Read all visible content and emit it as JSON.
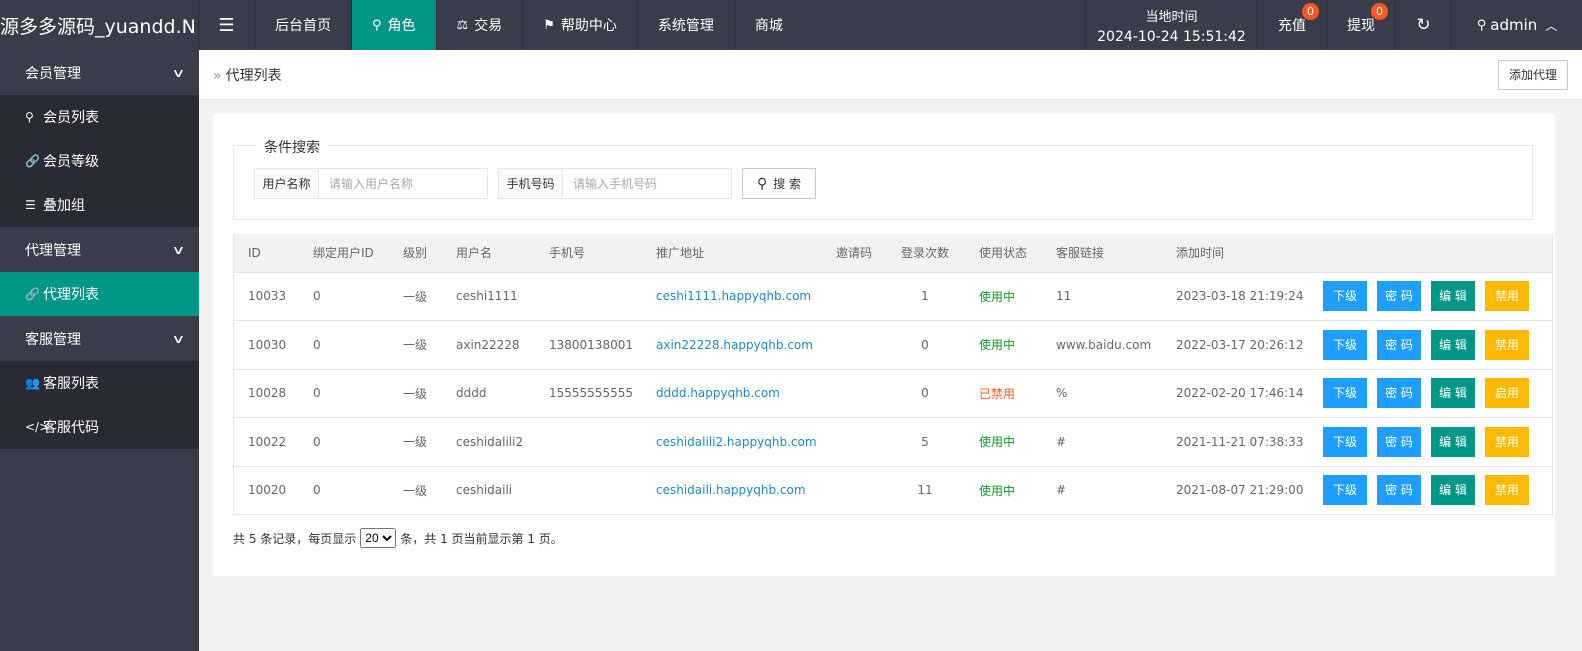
{
  "header": {
    "logo": "源多多源码_yuandd.N...",
    "nav": [
      {
        "label": "后台首页",
        "icon": ""
      },
      {
        "label": "角色",
        "icon": "user-icon"
      },
      {
        "label": "交易",
        "icon": "scale-icon"
      },
      {
        "label": "帮助中心",
        "icon": "flag-icon"
      },
      {
        "label": "系统管理",
        "icon": ""
      },
      {
        "label": "商城",
        "icon": ""
      }
    ],
    "time_label": "当地时间",
    "time_value": "2024-10-24 15:51:42",
    "recharge": {
      "label": "充值",
      "badge": "0"
    },
    "withdraw": {
      "label": "提现",
      "badge": "0"
    },
    "user": "admin"
  },
  "sidebar": {
    "groups": [
      {
        "label": "会员管理",
        "items": [
          "会员列表",
          "会员等级",
          "叠加组"
        ]
      },
      {
        "label": "代理管理",
        "items": [
          "代理列表"
        ]
      },
      {
        "label": "客服管理",
        "items": [
          "客服列表",
          "客服代码"
        ]
      }
    ]
  },
  "breadcrumb": "代理列表",
  "add_button": "添加代理",
  "search": {
    "legend": "条件搜索",
    "username_label": "用户名称",
    "username_placeholder": "请输入用户名称",
    "phone_label": "手机号码",
    "phone_placeholder": "请输入手机号码",
    "button": "搜 索"
  },
  "table": {
    "headers": [
      "ID",
      "绑定用户ID",
      "级别",
      "用户名",
      "手机号",
      "推广地址",
      "邀请码",
      "登录次数",
      "使用状态",
      "客服链接",
      "添加时间",
      ""
    ],
    "rows": [
      {
        "id": "10033",
        "bind": "0",
        "level": "一级",
        "username": "ceshi1111",
        "phone": "",
        "url": "ceshi1111.happyqhb.com",
        "invite": "",
        "logins": "1",
        "status": "使用中",
        "service": "11",
        "time": "2023-03-18 21:19:24",
        "toggle": "禁用"
      },
      {
        "id": "10030",
        "bind": "0",
        "level": "一级",
        "username": "axin22228",
        "phone": "13800138001",
        "url": "axin22228.happyqhb.com",
        "invite": "",
        "logins": "0",
        "status": "使用中",
        "service": "www.baidu.com",
        "time": "2022-03-17 20:26:12",
        "toggle": "禁用"
      },
      {
        "id": "10028",
        "bind": "0",
        "level": "一级",
        "username": "dddd",
        "phone": "15555555555",
        "url": "dddd.happyqhb.com",
        "invite": "",
        "logins": "0",
        "status": "已禁用",
        "service": "%",
        "time": "2022-02-20 17:46:14",
        "toggle": "启用"
      },
      {
        "id": "10022",
        "bind": "0",
        "level": "一级",
        "username": "ceshidalili2",
        "phone": "",
        "url": "ceshidalili2.happyqhb.com",
        "invite": "",
        "logins": "5",
        "status": "使用中",
        "service": "#",
        "time": "2021-11-21 07:38:33",
        "toggle": "禁用"
      },
      {
        "id": "10020",
        "bind": "0",
        "level": "一级",
        "username": "ceshidaili",
        "phone": "",
        "url": "ceshidaili.happyqhb.com",
        "invite": "",
        "logins": "11",
        "status": "使用中",
        "service": "#",
        "time": "2021-08-07 21:29:00",
        "toggle": "禁用"
      }
    ],
    "actions": {
      "sub": "下级",
      "pwd": "密 码",
      "edit": "编 辑"
    }
  },
  "pager": {
    "prefix": "共 5 条记录，每页显示",
    "page_size": "20",
    "suffix": "条，共 1 页当前显示第 1 页。"
  },
  "colors": {
    "accent": "#009688",
    "blue": "#1e9fff",
    "yellow": "#ffb800",
    "dark": "#393d49"
  }
}
